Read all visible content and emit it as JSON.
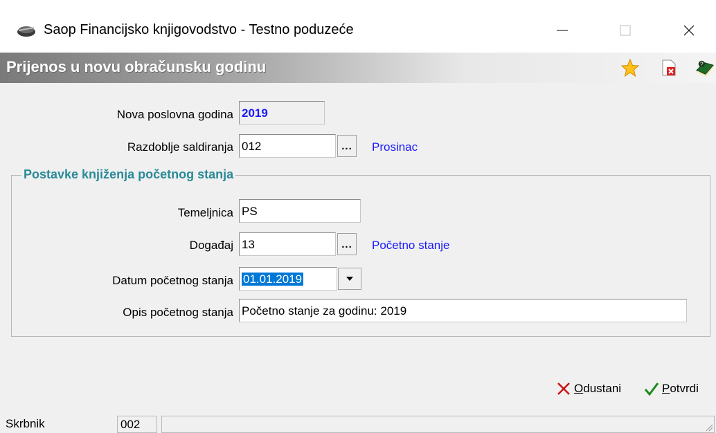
{
  "window": {
    "title": "Saop Financijsko knjigovodstvo - Testno poduzeće",
    "minimize_icon": "minimize-icon",
    "maximize_icon": "maximize-icon",
    "close_icon": "close-icon"
  },
  "header": {
    "title": "Prijenos u novu obračunsku godinu",
    "icons": [
      "star-icon",
      "document-delete-icon",
      "help-book-icon"
    ]
  },
  "form": {
    "nova_poslovna_godina": {
      "label": "Nova poslovna godina",
      "value": "2019"
    },
    "razdoblje_saldiranja": {
      "label": "Razdoblje saldiranja",
      "value": "012",
      "lookup_label": "...",
      "description": "Prosinac"
    },
    "group": {
      "title": "Postavke knjiženja početnog stanja",
      "temeljnica": {
        "label": "Temeljnica",
        "value": "PS"
      },
      "dogadjaj": {
        "label": "Događaj",
        "value": "13",
        "lookup_label": "...",
        "description": "Početno stanje"
      },
      "datum": {
        "label": "Datum početnog stanja",
        "value": "01.01.2019"
      },
      "opis": {
        "label": "Opis početnog stanja",
        "value": "Početno stanje za godinu: 2019"
      }
    }
  },
  "actions": {
    "cancel": {
      "first": "O",
      "rest": "dustani"
    },
    "confirm": {
      "first": "P",
      "rest": "otvrdi"
    }
  },
  "status": {
    "user": "Skrbnik",
    "code": "002",
    "message": ""
  },
  "colors": {
    "link": "#1a1aff",
    "group_title": "#2a8a98",
    "selection": "#0078d7",
    "cancel_icon": "#cc1111",
    "confirm_icon": "#1a8a1a"
  }
}
